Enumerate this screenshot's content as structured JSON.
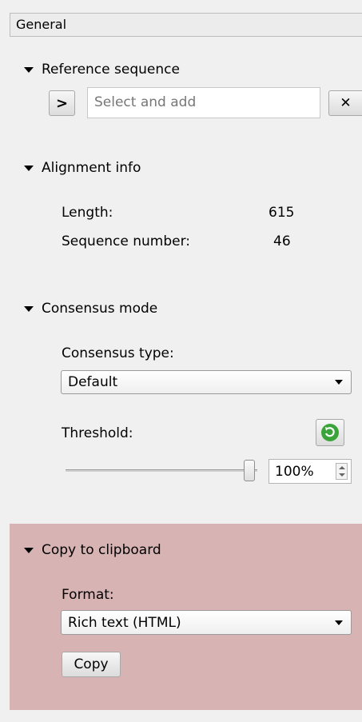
{
  "header": {
    "title": "General"
  },
  "reference": {
    "title": "Reference sequence",
    "placeholder": "Select and add",
    "go_glyph": ">",
    "clear_glyph": "✕"
  },
  "alignment": {
    "title": "Alignment info",
    "length_label": "Length:",
    "length_value": "615",
    "seqnum_label": "Sequence number:",
    "seqnum_value": "46"
  },
  "consensus": {
    "title": "Consensus mode",
    "type_label": "Consensus type:",
    "type_value": "Default",
    "threshold_label": "Threshold:",
    "threshold_value": "100%",
    "threshold_level": 1.0
  },
  "clipboard": {
    "title": "Copy to clipboard",
    "format_label": "Format:",
    "format_value": "Rich text (HTML)",
    "copy_label": "Copy"
  },
  "colors": {
    "clipboard_bg": "#d7b3b3",
    "reset_icon": "#3aa43a"
  },
  "icons": {
    "collapse": "triangle-down-icon",
    "go": "chevron-right-icon",
    "clear": "close-icon",
    "reset": "reset-icon",
    "spin": "spin-arrows-icon",
    "dropdown": "chevron-down-icon"
  }
}
